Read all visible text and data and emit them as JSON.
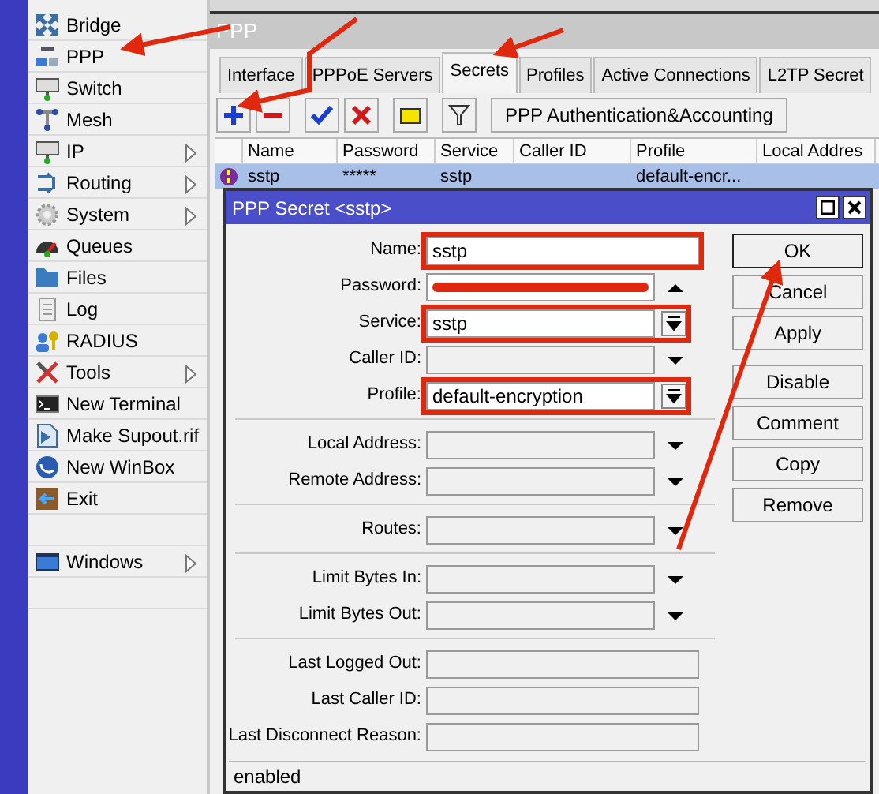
{
  "sidebar": {
    "items": [
      {
        "label": "Bridge",
        "submenu": false
      },
      {
        "label": "PPP",
        "submenu": false
      },
      {
        "label": "Switch",
        "submenu": false
      },
      {
        "label": "Mesh",
        "submenu": false
      },
      {
        "label": "IP",
        "submenu": true
      },
      {
        "label": "Routing",
        "submenu": true
      },
      {
        "label": "System",
        "submenu": true
      },
      {
        "label": "Queues",
        "submenu": false
      },
      {
        "label": "Files",
        "submenu": false
      },
      {
        "label": "Log",
        "submenu": false
      },
      {
        "label": "RADIUS",
        "submenu": false
      },
      {
        "label": "Tools",
        "submenu": true
      },
      {
        "label": "New Terminal",
        "submenu": false
      },
      {
        "label": "Make Supout.rif",
        "submenu": false
      },
      {
        "label": "New WinBox",
        "submenu": false
      },
      {
        "label": "Exit",
        "submenu": false
      }
    ],
    "bottom_items": [
      {
        "label": "Windows",
        "submenu": true
      }
    ]
  },
  "window": {
    "title": "PPP",
    "tabs": [
      {
        "label": "Interface",
        "selected": false
      },
      {
        "label": "PPPoE Servers",
        "selected": false
      },
      {
        "label": "Secrets",
        "selected": true
      },
      {
        "label": "Profiles",
        "selected": false
      },
      {
        "label": "Active Connections",
        "selected": false
      },
      {
        "label": "L2TP Secret",
        "selected": false
      }
    ],
    "toolbar": {
      "button": "PPP Authentication&Accounting"
    },
    "table": {
      "columns": [
        "Name",
        "Password",
        "Service",
        "Caller ID",
        "Profile",
        "Local Addres"
      ],
      "rows": [
        {
          "cells": [
            "sstp",
            "*****",
            "sstp",
            "",
            "default-encr..."
          ],
          "selected": true
        }
      ]
    }
  },
  "dialog": {
    "title": "PPP Secret <sstp>",
    "groups": [
      [
        {
          "label": "Name:",
          "kind": "text",
          "value": "sstp",
          "highlighted": true
        },
        {
          "label": "Password:",
          "kind": "password",
          "redacted": true,
          "highlighted": false
        },
        {
          "label": "Service:",
          "kind": "combo",
          "value": "sstp",
          "highlighted": true
        },
        {
          "label": "Caller ID:",
          "kind": "dropdown",
          "highlighted": false
        },
        {
          "label": "Profile:",
          "kind": "combo",
          "value": "default-encryption",
          "highlighted": true
        }
      ],
      [
        {
          "label": "Local Address:",
          "kind": "dropdown",
          "highlighted": false
        },
        {
          "label": "Remote Address:",
          "kind": "dropdown",
          "highlighted": false
        }
      ],
      [
        {
          "label": "Routes:",
          "kind": "dropdown",
          "highlighted": false
        }
      ],
      [
        {
          "label": "Limit Bytes In:",
          "kind": "dropdown",
          "highlighted": false
        },
        {
          "label": "Limit Bytes Out:",
          "kind": "dropdown",
          "highlighted": false
        }
      ],
      [
        {
          "label": "Last Logged Out:",
          "kind": "readonly",
          "highlighted": false
        },
        {
          "label": "Last Caller ID:",
          "kind": "readonly",
          "highlighted": false
        },
        {
          "label": "Last Disconnect Reason:",
          "kind": "readonly",
          "highlighted": false
        }
      ]
    ],
    "button_groups": [
      [
        {
          "label": "OK",
          "default": true
        },
        {
          "label": "Cancel",
          "default": false
        },
        {
          "label": "Apply",
          "default": false
        }
      ],
      [
        {
          "label": "Disable",
          "default": false
        },
        {
          "label": "Comment",
          "default": false
        },
        {
          "label": "Copy",
          "default": false
        },
        {
          "label": "Remove",
          "default": false
        }
      ]
    ],
    "status": "enabled"
  }
}
